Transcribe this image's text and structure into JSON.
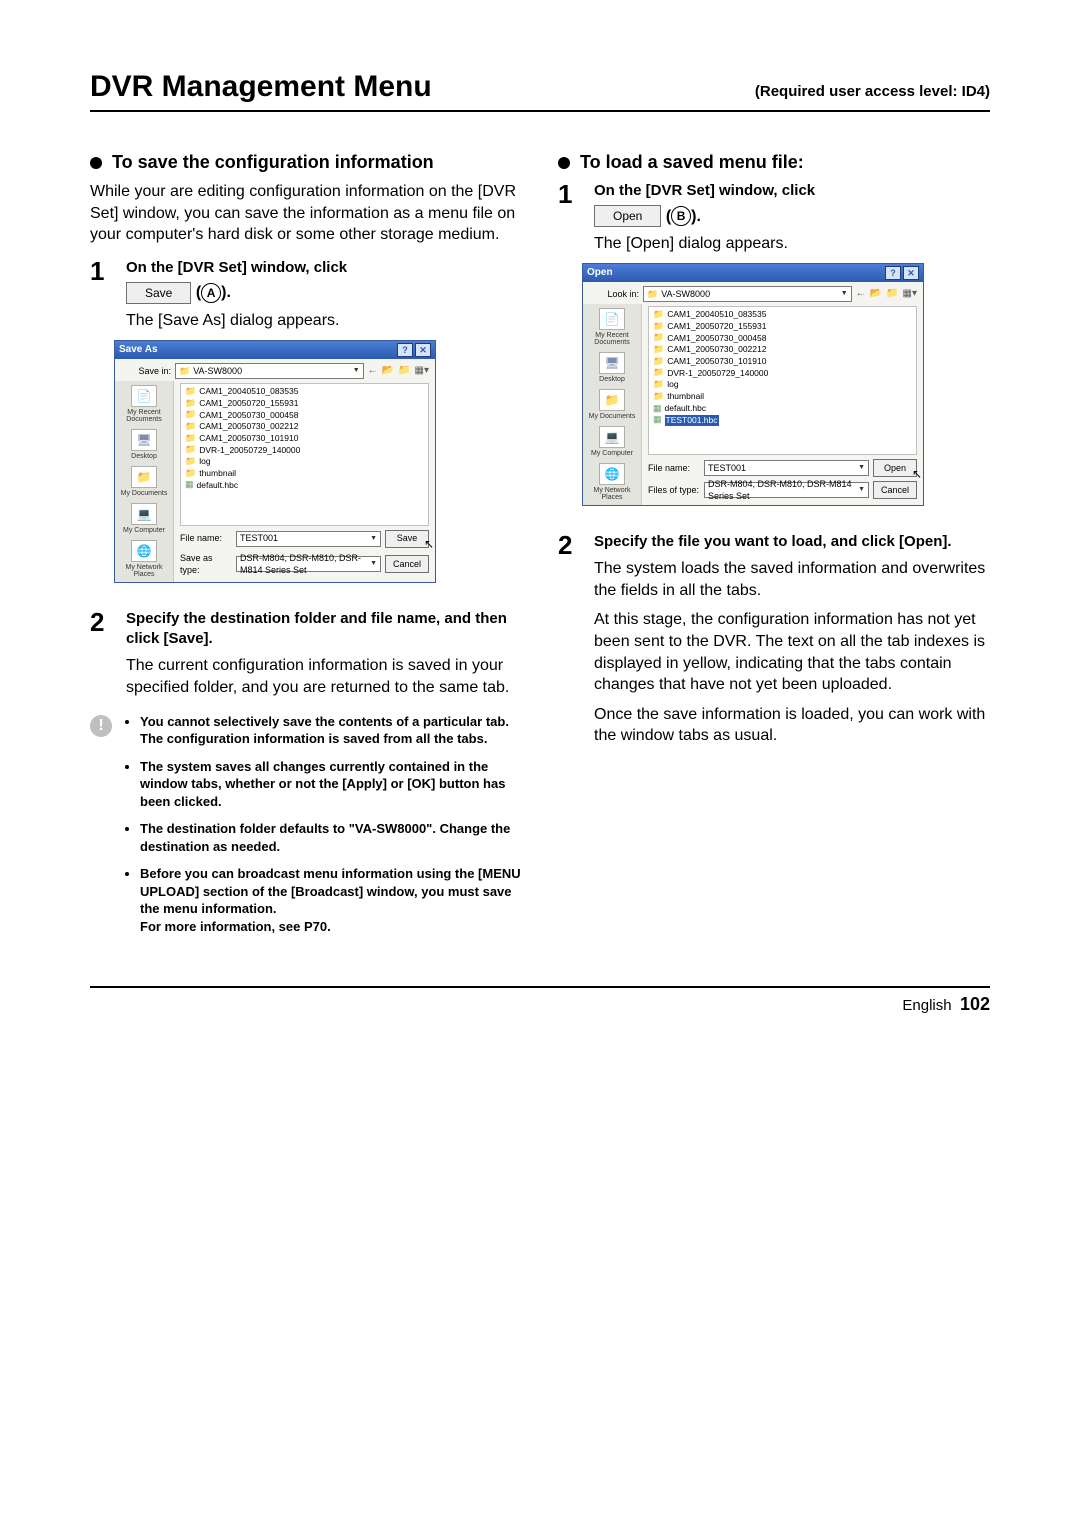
{
  "header": {
    "title": "DVR Management Menu",
    "requirement": "(Required user access level: ID4)"
  },
  "left": {
    "heading": "To save the configuration information",
    "intro": "While your are editing configuration information on the [DVR Set] window, you can save the information as a menu file on your computer's hard disk or some other storage medium.",
    "step1_title": "On the [DVR Set] window, click",
    "save_button": "Save",
    "circle_a": "A",
    "step1_paren_open": " (",
    "step1_paren_close": ").",
    "step1_body": "The [Save As] dialog appears.",
    "step2_title": "Specify the destination folder and file name, and then click [Save].",
    "step2_body": "The current configuration information is saved in your specified folder, and you are returned to the same tab.",
    "warnings": [
      "You cannot selectively save the contents of a particular tab. The configuration information is saved from all the tabs.",
      "The system saves all changes currently contained in the window tabs, whether or not the [Apply] or [OK] button has been clicked.",
      "The destination folder defaults to \"VA-SW8000\". Change the destination as needed.",
      "Before you can broadcast menu information using the [MENU UPLOAD] section of the [Broadcast] window, you must save the menu information.\nFor more information, see P70."
    ]
  },
  "right": {
    "heading": "To load a saved menu file:",
    "step1_title": "On the [DVR Set] window, click",
    "open_button": "Open",
    "circle_b": "B",
    "step1_body": "The [Open] dialog appears.",
    "step2_title": "Specify the file you want to load, and click [Open].",
    "step2_body1": "The system loads the saved information and overwrites the fields in all the tabs.",
    "step2_body2": "At this stage, the configuration information has not yet been sent to the DVR. The text on all the tab indexes is displayed in yellow, indicating that the tabs contain changes that have not yet been uploaded.",
    "step2_body3": "Once the save information is loaded, you can work with the window tabs as usual."
  },
  "saveAsDialog": {
    "title": "Save As",
    "savein_label": "Save in:",
    "savein_value": "VA-SW8000",
    "places": [
      "My Recent Documents",
      "Desktop",
      "My Documents",
      "My Computer",
      "My Network Places"
    ],
    "files": [
      {
        "type": "folder",
        "name": "CAM1_20040510_083535"
      },
      {
        "type": "folder",
        "name": "CAM1_20050720_155931"
      },
      {
        "type": "folder",
        "name": "CAM1_20050730_000458"
      },
      {
        "type": "folder",
        "name": "CAM1_20050730_002212"
      },
      {
        "type": "folder",
        "name": "CAM1_20050730_101910"
      },
      {
        "type": "folder",
        "name": "DVR-1_20050729_140000"
      },
      {
        "type": "folder",
        "name": "log"
      },
      {
        "type": "folder",
        "name": "thumbnail"
      },
      {
        "type": "file",
        "name": "default.hbc"
      }
    ],
    "filename_label": "File name:",
    "filename_value": "TEST001",
    "type_label": "Save as type:",
    "type_value": "DSR-M804, DSR-M810, DSR-M814 Series Set",
    "primary": "Save",
    "secondary": "Cancel"
  },
  "openDialog": {
    "title": "Open",
    "lookin_label": "Look in:",
    "lookin_value": "VA-SW8000",
    "places": [
      "My Recent Documents",
      "Desktop",
      "My Documents",
      "My Computer",
      "My Network Places"
    ],
    "files": [
      {
        "type": "folder",
        "name": "CAM1_20040510_083535"
      },
      {
        "type": "folder",
        "name": "CAM1_20050720_155931"
      },
      {
        "type": "folder",
        "name": "CAM1_20050730_000458"
      },
      {
        "type": "folder",
        "name": "CAM1_20050730_002212"
      },
      {
        "type": "folder",
        "name": "CAM1_20050730_101910"
      },
      {
        "type": "folder",
        "name": "DVR-1_20050729_140000"
      },
      {
        "type": "folder",
        "name": "log"
      },
      {
        "type": "folder",
        "name": "thumbnail"
      },
      {
        "type": "file",
        "name": "default.hbc"
      },
      {
        "type": "file",
        "name": "TEST001.hbc",
        "selected": true
      }
    ],
    "filename_label": "File name:",
    "filename_value": "TEST001",
    "type_label": "Files of type:",
    "type_value": "DSR-M804, DSR-M810, DSR-M814 Series Set",
    "primary": "Open",
    "secondary": "Cancel"
  },
  "footer": {
    "lang": "English",
    "page": "102"
  }
}
